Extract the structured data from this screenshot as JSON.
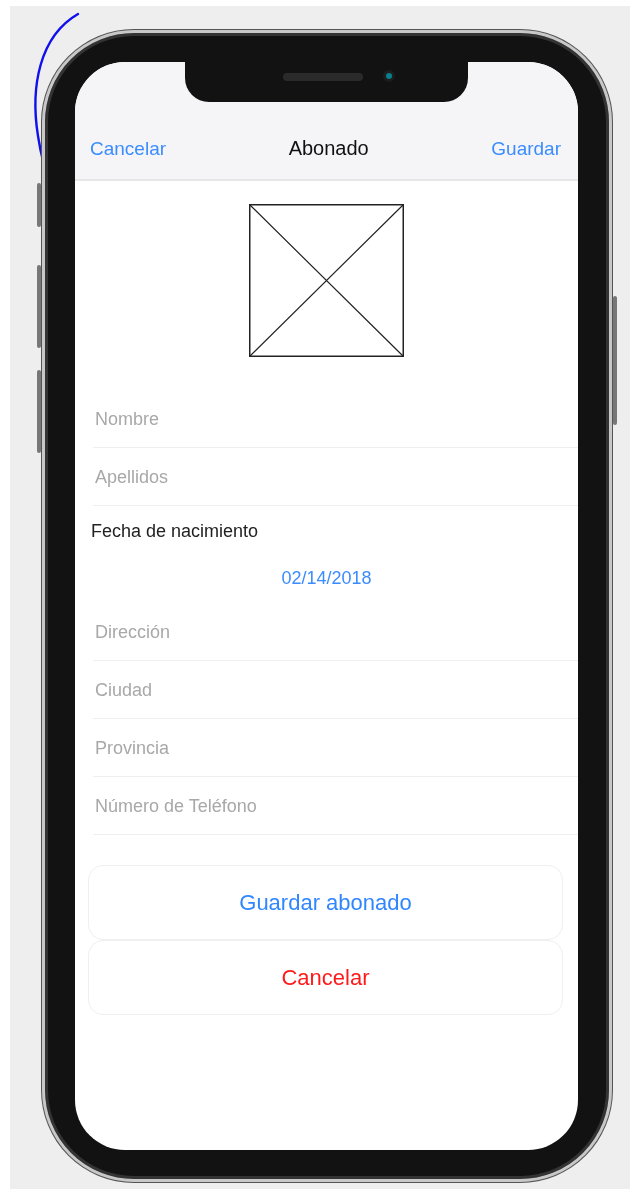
{
  "nav": {
    "left": "Cancelar",
    "title": "Abonado",
    "right": "Guardar"
  },
  "fields": [
    {
      "kind": "input",
      "placeholder": "Nombre"
    },
    {
      "kind": "input",
      "placeholder": "Apellidos"
    },
    {
      "kind": "date",
      "label": "Fecha de nacimiento",
      "value": "02/14/2018"
    },
    {
      "kind": "input",
      "placeholder": "Dirección"
    },
    {
      "kind": "input",
      "placeholder": "Ciudad"
    },
    {
      "kind": "input",
      "placeholder": "Provincia"
    },
    {
      "kind": "input",
      "placeholder": "Número de Teléfono"
    }
  ],
  "buttons": [
    {
      "label": "Guardar abonado",
      "kind": "primary"
    },
    {
      "label": "Cancelar",
      "kind": "destructive"
    }
  ]
}
